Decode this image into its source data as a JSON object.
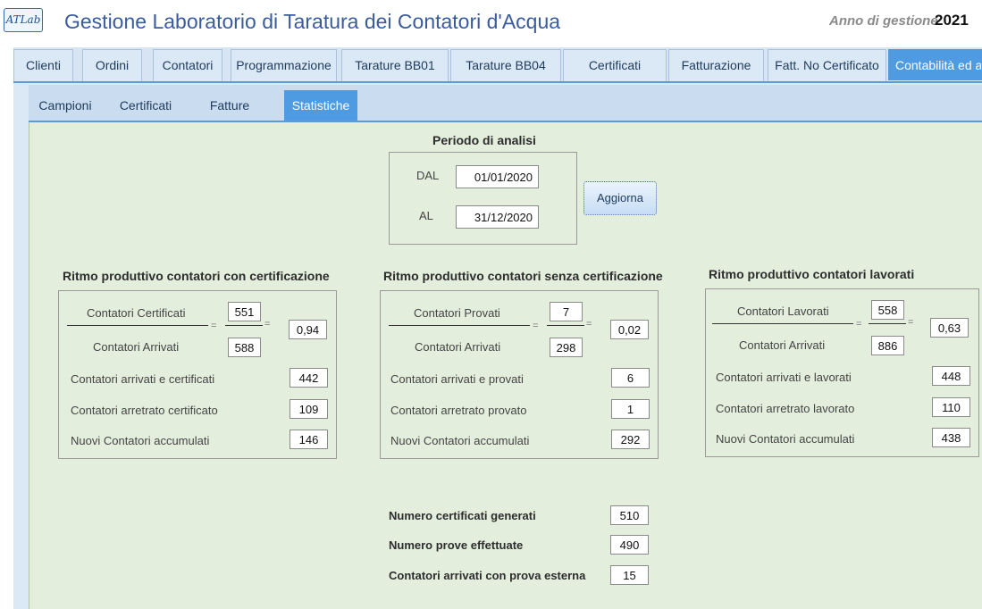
{
  "header": {
    "logo_text": "ATLab",
    "title": "Gestione Laboratorio di Taratura dei Contatori d'Acqua",
    "year_label": "Anno di gestione",
    "year_value": "2021"
  },
  "main_tabs": [
    {
      "label": "Clienti"
    },
    {
      "label": "Ordini"
    },
    {
      "label": "Contatori"
    },
    {
      "label": "Programmazione"
    },
    {
      "label": "Tarature BB01"
    },
    {
      "label": "Tarature BB04"
    },
    {
      "label": "Certificati"
    },
    {
      "label": "Fatturazione"
    },
    {
      "label": "Fatt. No Certificato"
    },
    {
      "label": "Contabilità ed a"
    }
  ],
  "sub_tabs": [
    {
      "label": "Campioni"
    },
    {
      "label": "Certificati"
    },
    {
      "label": "Fatture"
    },
    {
      "label": "Statistiche"
    }
  ],
  "period": {
    "title": "Periodo di analisi",
    "from_label": "DAL",
    "from_value": "01/01/2020",
    "to_label": "AL",
    "to_value": "31/12/2020",
    "refresh_label": "Aggiorna"
  },
  "sections": [
    {
      "title": "Ritmo produttivo contatori con certificazione",
      "numerator_label": "Contatori Certificati",
      "numerator_value": "551",
      "denominator_label": "Contatori Arrivati",
      "denominator_value": "588",
      "equals": "=",
      "ratio": "0,94",
      "rows": [
        {
          "label": "Contatori arrivati e certificati",
          "value": "442"
        },
        {
          "label": "Contatori arretrato certificato",
          "value": "109"
        },
        {
          "label": "Nuovi Contatori accumulati",
          "value": "146"
        }
      ]
    },
    {
      "title": "Ritmo produttivo contatori senza certificazione",
      "numerator_label": "Contatori Provati",
      "numerator_value": "7",
      "denominator_label": "Contatori Arrivati",
      "denominator_value": "298",
      "equals": "=",
      "ratio": "0,02",
      "rows": [
        {
          "label": "Contatori arrivati e provati",
          "value": "6"
        },
        {
          "label": "Contatori arretrato provato",
          "value": "1"
        },
        {
          "label": "Nuovi Contatori accumulati",
          "value": "292"
        }
      ]
    },
    {
      "title": "Ritmo produttivo contatori lavorati",
      "numerator_label": "Contatori Lavorati",
      "numerator_value": "558",
      "denominator_label": "Contatori Arrivati",
      "denominator_value": "886",
      "equals": "=",
      "ratio": "0,63",
      "rows": [
        {
          "label": "Contatori arrivati e lavorati",
          "value": "448"
        },
        {
          "label": "Contatori arretrato lavorato",
          "value": "110"
        },
        {
          "label": "Nuovi Contatori accumulati",
          "value": "438"
        }
      ]
    }
  ],
  "summary": [
    {
      "label": "Numero certificati generati",
      "value": "510"
    },
    {
      "label": "Numero prove effettuate",
      "value": "490"
    },
    {
      "label": "Contatori arrivati con prova esterna",
      "value": "15"
    }
  ]
}
